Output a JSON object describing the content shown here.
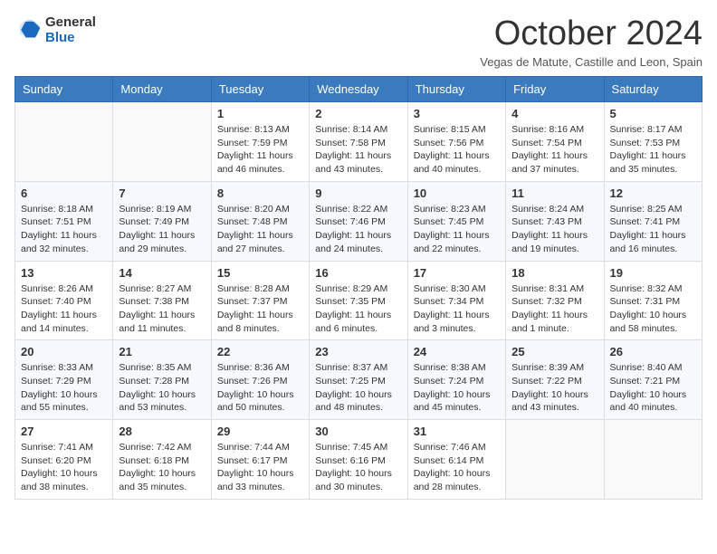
{
  "logo": {
    "text_general": "General",
    "text_blue": "Blue"
  },
  "header": {
    "month_title": "October 2024",
    "subtitle": "Vegas de Matute, Castille and Leon, Spain"
  },
  "days_of_week": [
    "Sunday",
    "Monday",
    "Tuesday",
    "Wednesday",
    "Thursday",
    "Friday",
    "Saturday"
  ],
  "weeks": [
    [
      {
        "day": "",
        "info": ""
      },
      {
        "day": "",
        "info": ""
      },
      {
        "day": "1",
        "info": "Sunrise: 8:13 AM\nSunset: 7:59 PM\nDaylight: 11 hours and 46 minutes."
      },
      {
        "day": "2",
        "info": "Sunrise: 8:14 AM\nSunset: 7:58 PM\nDaylight: 11 hours and 43 minutes."
      },
      {
        "day": "3",
        "info": "Sunrise: 8:15 AM\nSunset: 7:56 PM\nDaylight: 11 hours and 40 minutes."
      },
      {
        "day": "4",
        "info": "Sunrise: 8:16 AM\nSunset: 7:54 PM\nDaylight: 11 hours and 37 minutes."
      },
      {
        "day": "5",
        "info": "Sunrise: 8:17 AM\nSunset: 7:53 PM\nDaylight: 11 hours and 35 minutes."
      }
    ],
    [
      {
        "day": "6",
        "info": "Sunrise: 8:18 AM\nSunset: 7:51 PM\nDaylight: 11 hours and 32 minutes."
      },
      {
        "day": "7",
        "info": "Sunrise: 8:19 AM\nSunset: 7:49 PM\nDaylight: 11 hours and 29 minutes."
      },
      {
        "day": "8",
        "info": "Sunrise: 8:20 AM\nSunset: 7:48 PM\nDaylight: 11 hours and 27 minutes."
      },
      {
        "day": "9",
        "info": "Sunrise: 8:22 AM\nSunset: 7:46 PM\nDaylight: 11 hours and 24 minutes."
      },
      {
        "day": "10",
        "info": "Sunrise: 8:23 AM\nSunset: 7:45 PM\nDaylight: 11 hours and 22 minutes."
      },
      {
        "day": "11",
        "info": "Sunrise: 8:24 AM\nSunset: 7:43 PM\nDaylight: 11 hours and 19 minutes."
      },
      {
        "day": "12",
        "info": "Sunrise: 8:25 AM\nSunset: 7:41 PM\nDaylight: 11 hours and 16 minutes."
      }
    ],
    [
      {
        "day": "13",
        "info": "Sunrise: 8:26 AM\nSunset: 7:40 PM\nDaylight: 11 hours and 14 minutes."
      },
      {
        "day": "14",
        "info": "Sunrise: 8:27 AM\nSunset: 7:38 PM\nDaylight: 11 hours and 11 minutes."
      },
      {
        "day": "15",
        "info": "Sunrise: 8:28 AM\nSunset: 7:37 PM\nDaylight: 11 hours and 8 minutes."
      },
      {
        "day": "16",
        "info": "Sunrise: 8:29 AM\nSunset: 7:35 PM\nDaylight: 11 hours and 6 minutes."
      },
      {
        "day": "17",
        "info": "Sunrise: 8:30 AM\nSunset: 7:34 PM\nDaylight: 11 hours and 3 minutes."
      },
      {
        "day": "18",
        "info": "Sunrise: 8:31 AM\nSunset: 7:32 PM\nDaylight: 11 hours and 1 minute."
      },
      {
        "day": "19",
        "info": "Sunrise: 8:32 AM\nSunset: 7:31 PM\nDaylight: 10 hours and 58 minutes."
      }
    ],
    [
      {
        "day": "20",
        "info": "Sunrise: 8:33 AM\nSunset: 7:29 PM\nDaylight: 10 hours and 55 minutes."
      },
      {
        "day": "21",
        "info": "Sunrise: 8:35 AM\nSunset: 7:28 PM\nDaylight: 10 hours and 53 minutes."
      },
      {
        "day": "22",
        "info": "Sunrise: 8:36 AM\nSunset: 7:26 PM\nDaylight: 10 hours and 50 minutes."
      },
      {
        "day": "23",
        "info": "Sunrise: 8:37 AM\nSunset: 7:25 PM\nDaylight: 10 hours and 48 minutes."
      },
      {
        "day": "24",
        "info": "Sunrise: 8:38 AM\nSunset: 7:24 PM\nDaylight: 10 hours and 45 minutes."
      },
      {
        "day": "25",
        "info": "Sunrise: 8:39 AM\nSunset: 7:22 PM\nDaylight: 10 hours and 43 minutes."
      },
      {
        "day": "26",
        "info": "Sunrise: 8:40 AM\nSunset: 7:21 PM\nDaylight: 10 hours and 40 minutes."
      }
    ],
    [
      {
        "day": "27",
        "info": "Sunrise: 7:41 AM\nSunset: 6:20 PM\nDaylight: 10 hours and 38 minutes."
      },
      {
        "day": "28",
        "info": "Sunrise: 7:42 AM\nSunset: 6:18 PM\nDaylight: 10 hours and 35 minutes."
      },
      {
        "day": "29",
        "info": "Sunrise: 7:44 AM\nSunset: 6:17 PM\nDaylight: 10 hours and 33 minutes."
      },
      {
        "day": "30",
        "info": "Sunrise: 7:45 AM\nSunset: 6:16 PM\nDaylight: 10 hours and 30 minutes."
      },
      {
        "day": "31",
        "info": "Sunrise: 7:46 AM\nSunset: 6:14 PM\nDaylight: 10 hours and 28 minutes."
      },
      {
        "day": "",
        "info": ""
      },
      {
        "day": "",
        "info": ""
      }
    ]
  ]
}
